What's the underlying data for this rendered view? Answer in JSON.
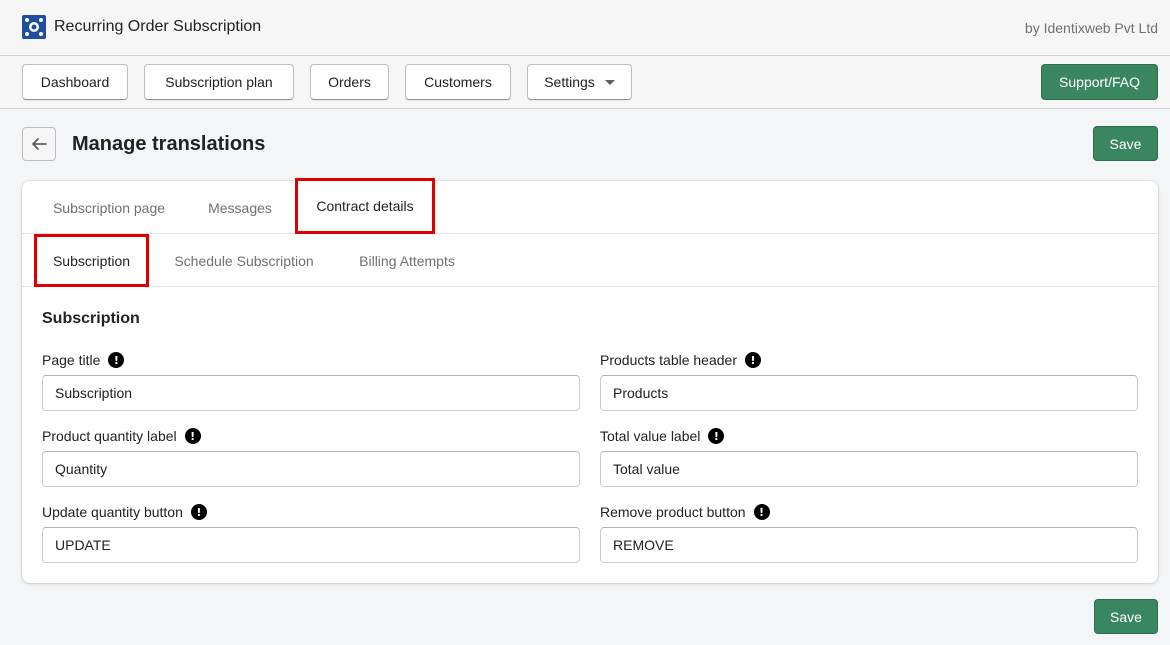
{
  "app": {
    "name": "Recurring Order Subscription",
    "byline": "by Identixweb Pvt Ltd",
    "logo_icon": "app-logo-icon"
  },
  "nav": {
    "items": [
      {
        "label": "Dashboard"
      },
      {
        "label": "Subscription plan"
      },
      {
        "label": "Orders"
      },
      {
        "label": "Customers"
      },
      {
        "label": "Settings"
      }
    ],
    "support_label": "Support/FAQ"
  },
  "header": {
    "title": "Manage translations",
    "save_label": "Save"
  },
  "tabs_primary": [
    {
      "label": "Subscription page"
    },
    {
      "label": "Messages"
    },
    {
      "label": "Contract details"
    }
  ],
  "tabs_secondary": [
    {
      "label": "Subscription"
    },
    {
      "label": "Schedule Subscription"
    },
    {
      "label": "Billing Attempts"
    }
  ],
  "section": {
    "title": "Subscription",
    "fields": [
      {
        "label": "Page title",
        "value": "Subscription"
      },
      {
        "label": "Products table header",
        "value": "Products"
      },
      {
        "label": "Product quantity label",
        "value": "Quantity"
      },
      {
        "label": "Total value label",
        "value": "Total value"
      },
      {
        "label": "Update quantity button",
        "value": "UPDATE"
      },
      {
        "label": "Remove product button",
        "value": "REMOVE"
      }
    ]
  },
  "footer": {
    "save_label": "Save"
  },
  "colors": {
    "primary_button": "#3a8661",
    "highlight_border": "#e00000"
  }
}
